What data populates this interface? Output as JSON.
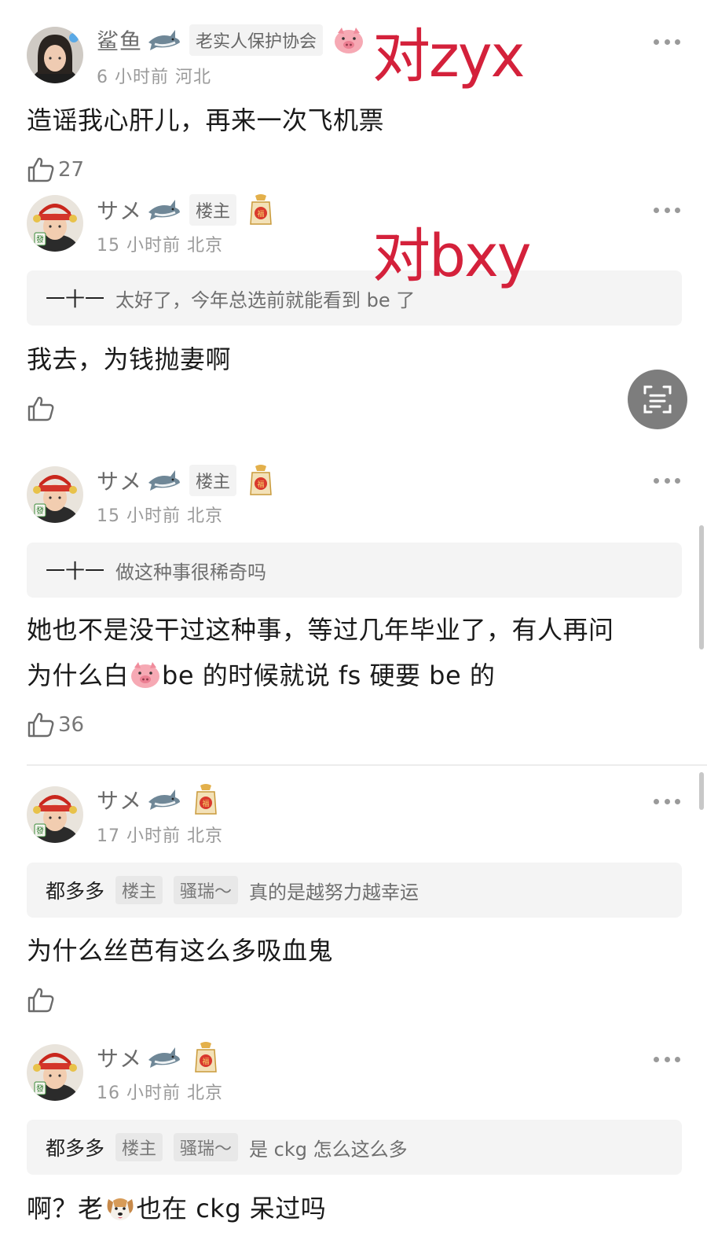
{
  "comments": [
    {
      "username": "鲨鱼",
      "tag": "老实人保护协会",
      "meta": "6 小时前  河北",
      "text": "造谣我心肝儿，再来一次飞机票",
      "likes": "27"
    },
    {
      "username": "サメ",
      "tag": "楼主",
      "meta": "15 小时前  北京",
      "quote_name": "一十一",
      "quote_text": "太好了，今年总选前就能看到 be 了",
      "text": "我去，为钱抛妻啊",
      "likes": ""
    },
    {
      "username": "サメ",
      "tag": "楼主",
      "meta": "15 小时前  北京",
      "quote_name": "一十一",
      "quote_text": "做这种事很稀奇吗",
      "text_line1": "她也不是没干过这种事，等过几年毕业了，有人再问",
      "text_line2_a": "为什么白",
      "text_line2_b": "be 的时候就说 fs 硬要 be 的",
      "likes": "36"
    },
    {
      "username": "サメ",
      "meta": "17 小时前  北京",
      "quote_name": "都多多",
      "quote_tag1": "楼主",
      "quote_tag2": "骚瑞～",
      "quote_text": "真的是越努力越幸运",
      "text": "为什么丝芭有这么多吸血鬼",
      "likes": ""
    },
    {
      "username": "サメ",
      "meta": "16 小时前  北京",
      "quote_name": "都多多",
      "quote_tag1": "楼主",
      "quote_tag2": "骚瑞～",
      "quote_text": "是 ckg 怎么这么多",
      "text_a": "啊？老",
      "text_b": "也在 ckg 呆过吗",
      "likes": ""
    }
  ],
  "overlays": {
    "first": "对zyx",
    "second": "对bxy"
  },
  "colors": {
    "overlay_red": "#d4213b",
    "meta_gray": "#9a9a9a",
    "quote_bg": "#f4f4f4"
  },
  "icons": [
    "more-icon",
    "like-icon",
    "shark-icon",
    "fortune-bag-icon",
    "pig-badge-icon",
    "scan-icon",
    "avatar"
  ]
}
